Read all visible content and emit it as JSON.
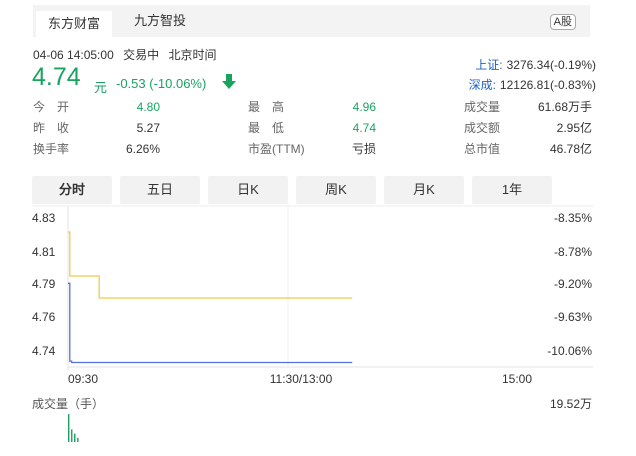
{
  "tabs": [
    {
      "label": "东方财富",
      "active": true
    },
    {
      "label": "九方智投",
      "active": false
    }
  ],
  "market_badge": "A股",
  "meta": {
    "datetime": "04-06 14:05:00",
    "status": "交易中",
    "timezone": "北京时间"
  },
  "quote": {
    "price": "4.74",
    "unit": "元",
    "change": "-0.53 (-10.06%)",
    "direction_icon": "down-arrow-icon",
    "color": "#1aa360"
  },
  "indices": [
    {
      "name": "上证:",
      "value": "3276.34(-0.19%)"
    },
    {
      "name": "深成:",
      "value": "12126.81(-0.83%)"
    }
  ],
  "stats": [
    [
      {
        "label": "今　开",
        "value": "4.80",
        "tone": "g"
      },
      {
        "label": "最　高",
        "value": "4.96",
        "tone": "g"
      },
      {
        "label": "成交量",
        "value": "61.68万手",
        "tone": "k"
      }
    ],
    [
      {
        "label": "昨　收",
        "value": "5.27",
        "tone": "k"
      },
      {
        "label": "最　低",
        "value": "4.74",
        "tone": "g"
      },
      {
        "label": "成交额",
        "value": "2.95亿",
        "tone": "k"
      }
    ],
    [
      {
        "label": "换手率",
        "value": "6.26%",
        "tone": "k"
      },
      {
        "label": "市盈(TTM)",
        "value": "亏损",
        "tone": "k"
      },
      {
        "label": "总市值",
        "value": "46.78亿",
        "tone": "k"
      }
    ]
  ],
  "periods": [
    {
      "label": "分时",
      "active": true
    },
    {
      "label": "五日",
      "active": false
    },
    {
      "label": "日K",
      "active": false
    },
    {
      "label": "周K",
      "active": false
    },
    {
      "label": "月K",
      "active": false
    },
    {
      "label": "1年",
      "active": false
    }
  ],
  "chart_data": {
    "type": "line",
    "y_ticks": [
      "4.83",
      "4.81",
      "4.79",
      "4.76",
      "4.74"
    ],
    "pct_ticks": [
      "-8.35%",
      "-8.78%",
      "-9.20%",
      "-9.63%",
      "-10.06%"
    ],
    "ylim": [
      4.74,
      4.83
    ],
    "x_ticks": [
      "09:30",
      "11:30/13:00",
      "15:00"
    ],
    "total_minutes": 240,
    "series": [
      {
        "color": "#5470e6",
        "points": [
          [
            0,
            4.795
          ],
          [
            1,
            4.742
          ],
          [
            2,
            4.741
          ],
          [
            240,
            4.741
          ]
        ],
        "draw_until": 155
      },
      {
        "color": "#f2c94c",
        "points": [
          [
            0,
            4.83
          ],
          [
            1,
            4.8
          ],
          [
            16,
            4.8
          ],
          [
            17,
            4.785
          ],
          [
            155,
            4.785
          ]
        ],
        "draw_until": 155
      }
    ],
    "volume": {
      "title": "成交量（手）",
      "max_label": "19.52万",
      "bars": [
        [
          0,
          1.0
        ],
        [
          1,
          0.45
        ],
        [
          2,
          0.3
        ],
        [
          3,
          0.15
        ]
      ],
      "color": "#1aa360"
    }
  }
}
